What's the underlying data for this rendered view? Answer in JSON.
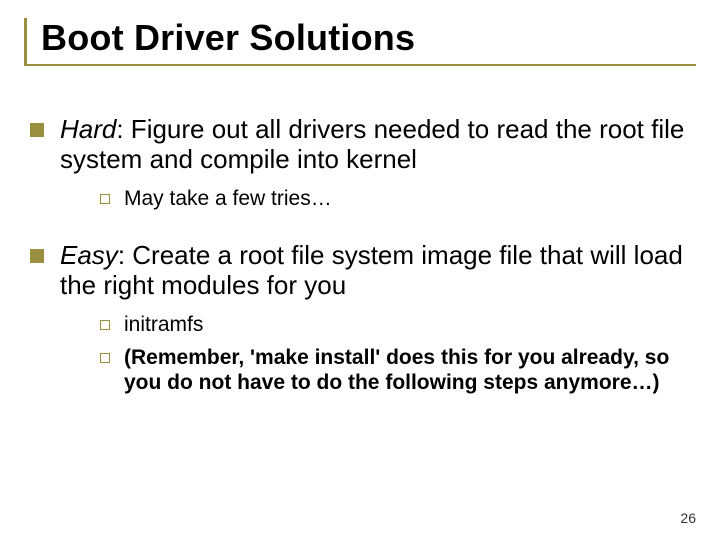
{
  "title": "Boot Driver Solutions",
  "bullets": [
    {
      "lead": "Hard",
      "rest": ": Figure out all drivers needed to read the root file system and compile into kernel",
      "sub": [
        {
          "text": "May take a few tries…",
          "bold": false
        }
      ]
    },
    {
      "lead": "Easy",
      "rest": ": Create a root file system image file that will load the right modules for you",
      "sub": [
        {
          "text": "initramfs",
          "bold": false
        },
        {
          "text": "(Remember, 'make install' does this for you already, so you do not have to do the following steps anymore…)",
          "bold": true
        }
      ]
    }
  ],
  "page_number": "26"
}
